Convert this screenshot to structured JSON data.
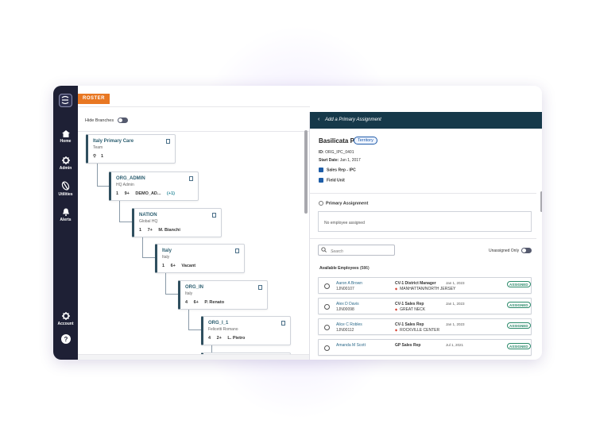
{
  "colors": {
    "accent": "#e87722",
    "sidebar": "#1e2035",
    "header": "#16394a",
    "link": "#2c6a8a",
    "assigned": "#2a8a6a"
  },
  "nav": [
    {
      "label": "Home",
      "icon": "home-icon"
    },
    {
      "label": "Admin",
      "icon": "gear-icon"
    },
    {
      "label": "Utilities",
      "icon": "utilities-icon"
    },
    {
      "label": "Alerts",
      "icon": "bell-icon"
    },
    {
      "label": "Account",
      "icon": "gear-icon"
    }
  ],
  "topbar": {
    "tab_label": "ROSTER"
  },
  "tree": {
    "hide_branches_label": "Hide Branches",
    "nodes": [
      {
        "title": "Italy Primary Care",
        "subtitle": "Team",
        "children": "1",
        "members": "",
        "owner": "",
        "extra": ""
      },
      {
        "title": "ORG_ADMIN",
        "subtitle": "HQ Admin",
        "children": "1",
        "members": "9+",
        "owner": "DEMO_AD...",
        "extra": "(+1)"
      },
      {
        "title": "NATION",
        "subtitle": "Global HQ",
        "children": "1",
        "members": "7+",
        "owner": "M. Bianchi",
        "extra": ""
      },
      {
        "title": "Italy",
        "subtitle": "Italy",
        "children": "1",
        "members": "6+",
        "owner": "Vacant",
        "extra": ""
      },
      {
        "title": "ORG_IN",
        "subtitle": "Italy",
        "children": "4",
        "members": "6+",
        "owner": "P. Renato",
        "extra": ""
      },
      {
        "title": "ORG_I_1",
        "subtitle": "Felicetti Romano",
        "children": "4",
        "members": "2+",
        "owner": "L. Pietro",
        "extra": ""
      }
    ]
  },
  "panel": {
    "header_title": "Add a Primary Assignment",
    "name": "Basilicata PC",
    "type_badge": "Territory",
    "id_label": "ID:",
    "id_value": "ORG_IPC_0401",
    "start_label": "Start Date:",
    "start_value": "Jan 1, 2017",
    "role": "Sales Rep - IPC",
    "unit": "Field Unit",
    "primary_assignment_label": "Primary Assignment",
    "no_employee_text": "No employee assigned",
    "search_placeholder": "Search",
    "unassigned_only_label": "Unassigned Only",
    "available_label": "Available Employees",
    "available_count": "(586)",
    "employees": [
      {
        "name": "Aaron A Brown",
        "id": "1JN00107",
        "role": "CV-1 District Manager",
        "territory": "MANHATTAN/NORTH JERSEY",
        "date": "Jan 1, 2023",
        "status": "ASSIGNED"
      },
      {
        "name": "Alex D Davis",
        "id": "1JN00098",
        "role": "CV-1 Sales Rep",
        "territory": "GREAT NECK",
        "date": "Jan 1, 2023",
        "status": "ASSIGNED"
      },
      {
        "name": "Alice C Robles",
        "id": "1JN00112",
        "role": "CV-1 Sales Rep",
        "territory": "ROCKVILLE CENTER",
        "date": "Jan 1, 2023",
        "status": "ASSIGNED"
      },
      {
        "name": "Amanda M Scott",
        "id": "",
        "role": "GP Sales Rep",
        "territory": "",
        "date": "Jul 1, 2021",
        "status": "ASSIGNED"
      }
    ]
  }
}
